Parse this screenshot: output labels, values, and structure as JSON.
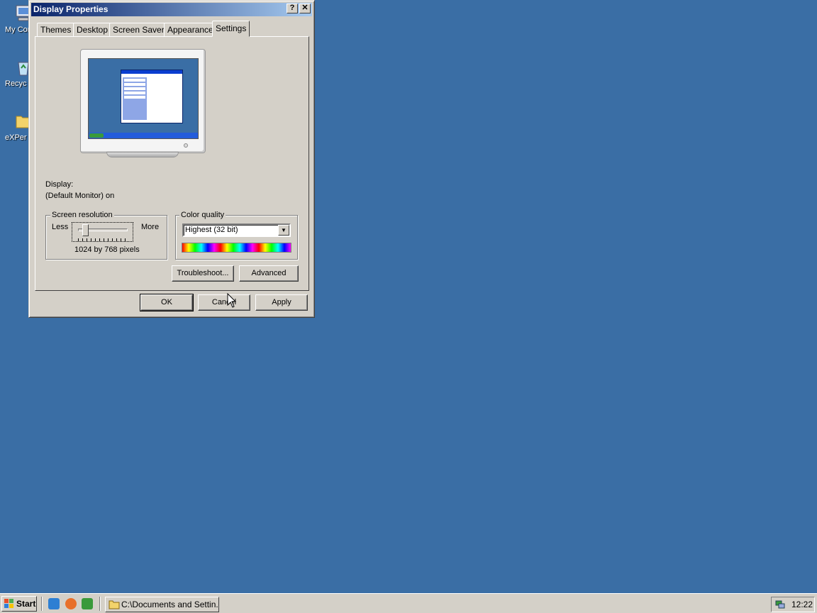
{
  "desktop": {
    "icons": [
      {
        "label": "My Con",
        "icon": "my-computer-icon"
      },
      {
        "label": "Recyc",
        "icon": "recycle-bin-icon"
      },
      {
        "label": "eXPer",
        "icon": "folder-icon"
      }
    ],
    "background_color": "#3a6ea5"
  },
  "window": {
    "title": "Display Properties",
    "help_button": "?",
    "close_button": "✕",
    "tabs": [
      "Themes",
      "Desktop",
      "Screen Saver",
      "Appearance",
      "Settings"
    ],
    "active_tab": "Settings",
    "display_label": "Display:",
    "display_value": "(Default Monitor) on",
    "resolution": {
      "group_label": "Screen resolution",
      "less_label": "Less",
      "more_label": "More",
      "value_text": "1024 by 768 pixels"
    },
    "color_quality": {
      "group_label": "Color quality",
      "selected": "Highest (32 bit)"
    },
    "buttons": {
      "troubleshoot": "Troubleshoot...",
      "advanced": "Advanced",
      "ok": "OK",
      "cancel": "Cancel",
      "apply": "Apply"
    }
  },
  "taskbar": {
    "start_label": "Start",
    "quick_launch": [
      "ie-icon",
      "firefox-icon",
      "show-desktop-icon"
    ],
    "task_button": "C:\\Documents and Settin...",
    "clock": "12:22"
  }
}
